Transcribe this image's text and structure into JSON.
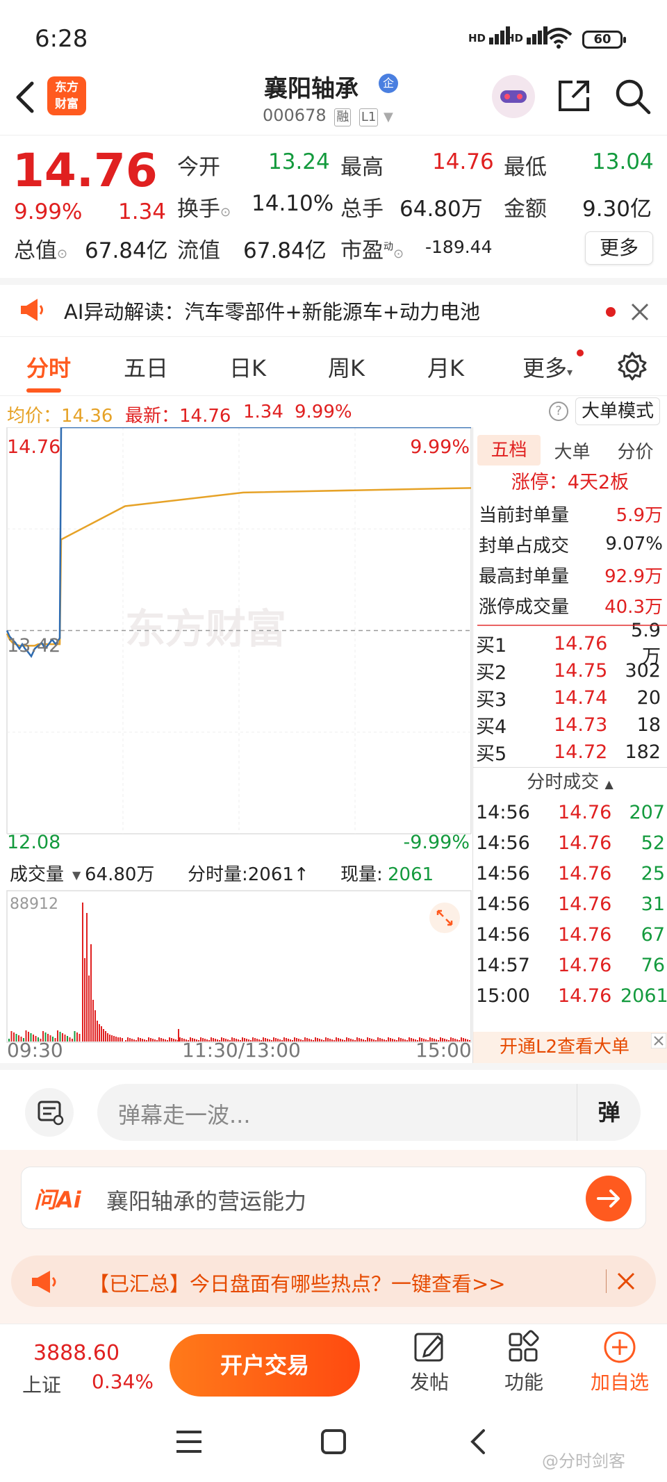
{
  "status_bar": {
    "time": "6:28",
    "sig1": "HD",
    "sig2": "HD",
    "battery": "60"
  },
  "header": {
    "logo_line1": "东方",
    "logo_line2": "财富",
    "stock_name": "襄阳轴承",
    "qi_badge": "企",
    "stock_code": "000678",
    "tag_rong": "融",
    "tag_level": "L1"
  },
  "quote": {
    "price": "14.76",
    "change_pct": "9.99%",
    "change_amt": "1.34",
    "open_label": "今开",
    "open_value": "13.24",
    "high_label": "最高",
    "high_value": "14.76",
    "low_label": "最低",
    "low_value": "13.04",
    "turnover_label": "换手",
    "turnover_value": "14.10%",
    "volume_label": "总手",
    "volume_value": "64.80万",
    "amount_label": "金额",
    "amount_value": "9.30亿",
    "mktcap_label": "总值",
    "mktcap_value": "67.84亿",
    "float_label": "流值",
    "float_value": "67.84亿",
    "pe_label": "市盈",
    "pe_sup": "动",
    "pe_value": "-189.44",
    "more_button": "更多"
  },
  "ai_banner": {
    "text": "AI异动解读：汽车零部件+新能源车+动力电池"
  },
  "tabs": [
    "分时",
    "五日",
    "日K",
    "周K",
    "月K",
    "更多"
  ],
  "infoline": {
    "avg_label": "均价：",
    "avg_value": "14.36",
    "latest_label": "最新：",
    "latest_value": "14.76",
    "change_amt": "1.34",
    "change_pct": "9.99%",
    "help_icon": "?",
    "mode_button": "大单模式"
  },
  "chart": {
    "price_top": "14.76",
    "price_mid": "13.42",
    "price_bottom": "12.08",
    "pct_top": "9.99%",
    "pct_bottom": "-9.99%",
    "watermark": "东方财富",
    "volume_label": "成交量",
    "volume_total": "64.80万",
    "period_vol_label": "分时量:2061↑",
    "current_vol_label": "现量:",
    "current_vol_value": "2061",
    "vol_max": "88912",
    "time_start": "09:30",
    "time_mid": "11:30/13:00",
    "time_end": "15:00"
  },
  "chart_data": {
    "type": "line",
    "series": [
      {
        "values": [
          13.42,
          13.38,
          13.36,
          13.34,
          13.3,
          13.33,
          13.3,
          13.28,
          13.25,
          13.3,
          13.32,
          13.34,
          13.3,
          13.33,
          13.36,
          13.33,
          13.35,
          13.37,
          14.76,
          14.76,
          14.76,
          14.76
        ]
      },
      {
        "values": [
          13.4,
          13.36,
          13.34,
          13.33,
          13.32,
          13.32,
          13.32,
          13.32,
          13.32,
          13.32,
          13.33,
          13.33,
          13.33,
          13.33,
          13.33,
          13.33,
          13.33,
          13.33,
          14.02,
          14.24,
          14.33,
          14.36
        ]
      }
    ],
    "ylim": [
      12.08,
      14.76
    ],
    "reference": 13.42
  },
  "side_panel": {
    "tabs": [
      "五档",
      "大单",
      "分价"
    ],
    "limit_up": "涨停：4天2板",
    "stats": [
      {
        "label": "当前封单量",
        "value": "5.9万"
      },
      {
        "label": "封单占成交",
        "value": "9.07%"
      },
      {
        "label": "最高封单量",
        "value": "92.9万"
      },
      {
        "label": "涨停成交量",
        "value": "40.3万"
      }
    ],
    "book": [
      {
        "label": "买1",
        "price": "14.76",
        "vol": "5.9万"
      },
      {
        "label": "买2",
        "price": "14.75",
        "vol": "302"
      },
      {
        "label": "买3",
        "price": "14.74",
        "vol": "20"
      },
      {
        "label": "买4",
        "price": "14.73",
        "vol": "18"
      },
      {
        "label": "买5",
        "price": "14.72",
        "vol": "182"
      }
    ],
    "trades_title": "分时成交",
    "trades": [
      {
        "time": "14:56",
        "price": "14.76",
        "vol": "207"
      },
      {
        "time": "14:56",
        "price": "14.76",
        "vol": "52"
      },
      {
        "time": "14:56",
        "price": "14.76",
        "vol": "25"
      },
      {
        "time": "14:56",
        "price": "14.76",
        "vol": "31"
      },
      {
        "time": "14:56",
        "price": "14.76",
        "vol": "67"
      },
      {
        "time": "14:57",
        "price": "14.76",
        "vol": "76"
      },
      {
        "time": "15:00",
        "price": "14.76",
        "vol": "2061"
      }
    ],
    "l2_promo": "开通L2查看大单"
  },
  "comment_bar": {
    "placeholder": "弹幕走一波...",
    "dan_label": "弹"
  },
  "wenai": {
    "logo": "问Ai",
    "prompt": "襄阳轴承的营运能力"
  },
  "hot_banner": {
    "text": "【已汇总】今日盘面有哪些热点？一键查看>>"
  },
  "bottom_bar": {
    "index_value": "3888.60",
    "index_name": "上证",
    "index_change": "0.34%",
    "trade_button": "开户交易",
    "post_label": "发帖",
    "function_label": "功能",
    "add_label": "加自选"
  },
  "navbar": {
    "watermark": "@分时剑客"
  },
  "colors": {
    "accent": "#ff5a1f",
    "up": "#e02020",
    "down": "#139a3d",
    "avg_line": "#e6a227",
    "price_line": "#2e6bb0"
  }
}
